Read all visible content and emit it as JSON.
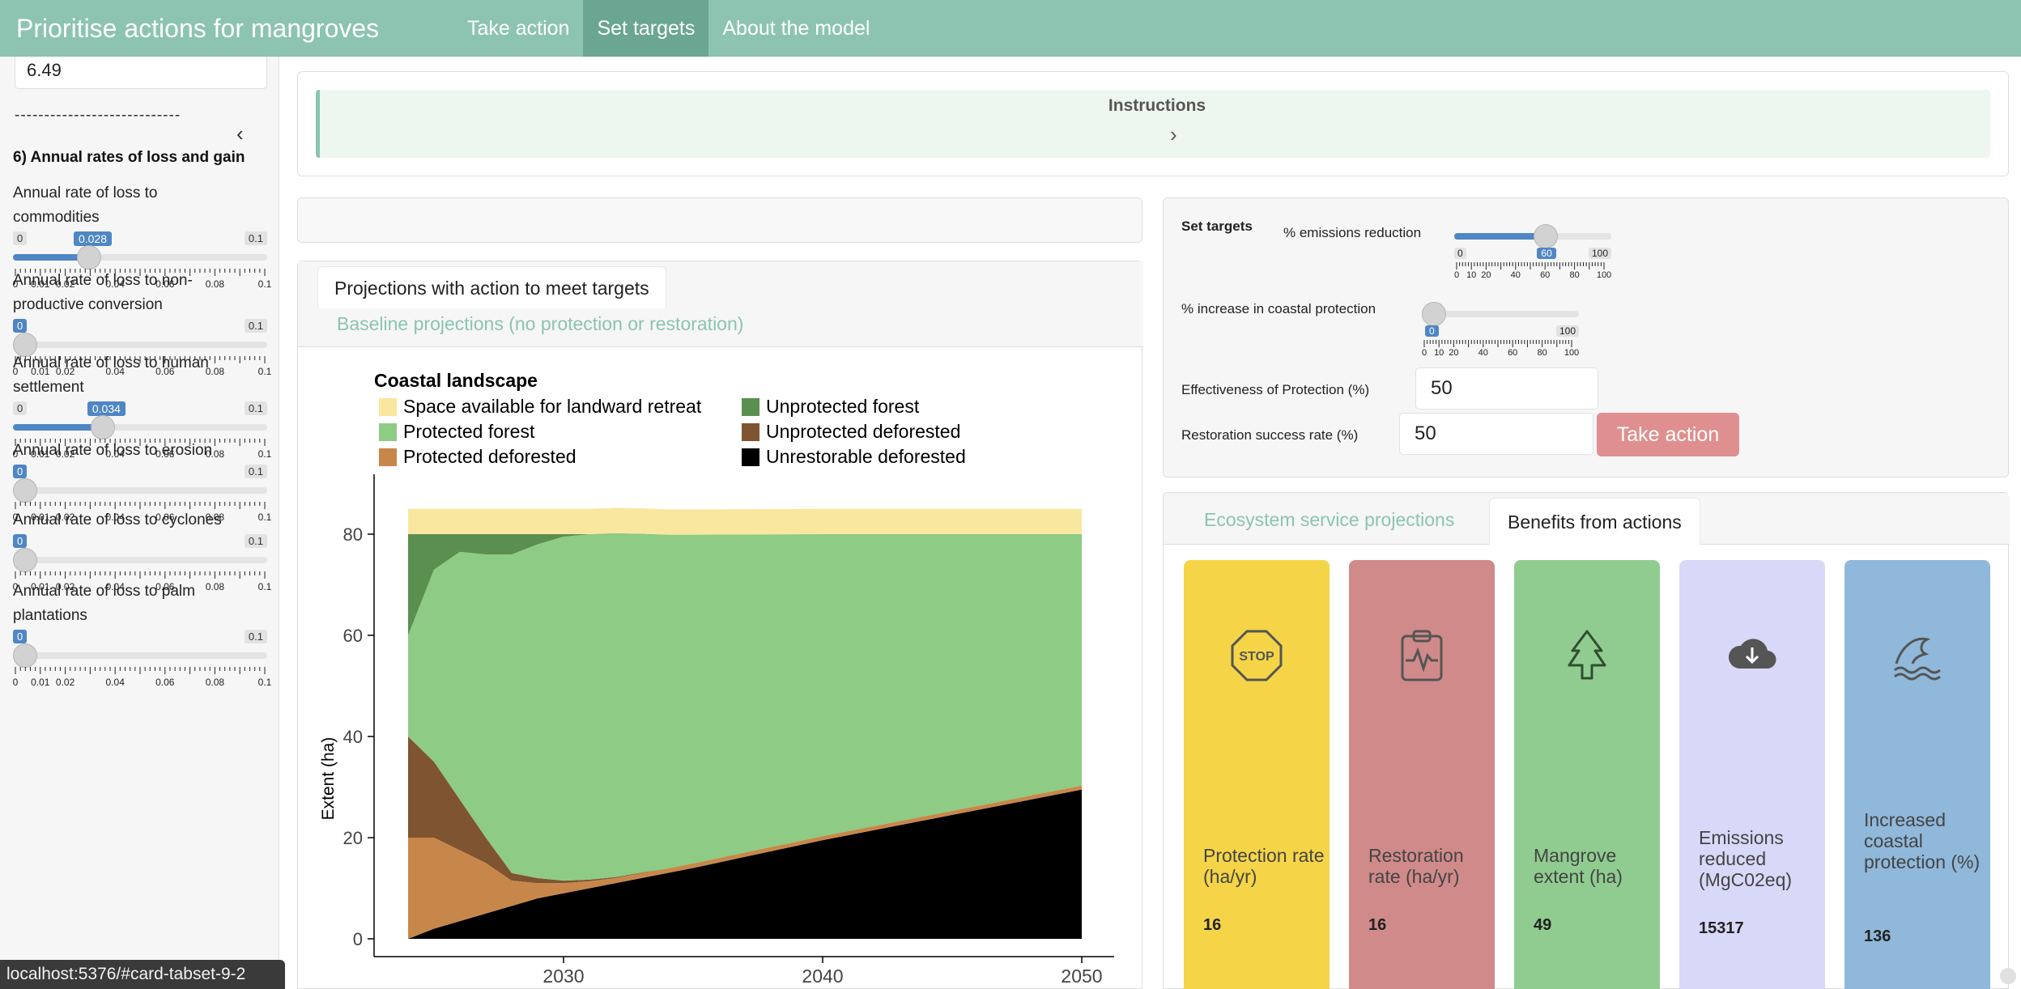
{
  "navbar": {
    "title": "Prioritise actions for mangroves",
    "links": [
      "Take action",
      "Set targets",
      "About the model"
    ],
    "active": "Set targets"
  },
  "sidebar": {
    "top_value": "6.49",
    "divider": "----------------------------",
    "section_heading": "6) Annual rates of loss and gain",
    "sliders": [
      {
        "label": "Annual rate of loss to commodities",
        "min": "0",
        "max": "0.1",
        "value": "0.028",
        "fraction": 0.28
      },
      {
        "label": "Annual rate of loss to non-productive conversion",
        "min": "0",
        "max": "0.1",
        "value": "0",
        "fraction": 0
      },
      {
        "label": "Annual rate of loss to human settlement",
        "min": "0",
        "max": "0.1",
        "value": "0.034",
        "fraction": 0.34
      },
      {
        "label": "Annual rate of loss to erosion",
        "min": "0",
        "max": "0.1",
        "value": "0",
        "fraction": 0
      },
      {
        "label": "Annual rate of loss to cyclones",
        "min": "0",
        "max": "0.1",
        "value": "0",
        "fraction": 0
      },
      {
        "label": "Annual rate of loss to palm plantations",
        "min": "0",
        "max": "0.1",
        "value": "0",
        "fraction": 0
      }
    ],
    "tick_labels": [
      "0",
      "0.01",
      "0.02",
      "0.04",
      "0.06",
      "0.08",
      "0.1"
    ]
  },
  "instructions": {
    "title": "Instructions"
  },
  "projections": {
    "tab_active": "Projections with action to meet targets",
    "tab_inactive": "Baseline projections (no protection or restoration)"
  },
  "chart_data": {
    "type": "area",
    "title": "Coastal landscape",
    "xlabel": "",
    "ylabel": "Extent (ha)",
    "xlim": [
      2024,
      2050
    ],
    "ylim": [
      0,
      88
    ],
    "x_ticks": [
      2030,
      2040,
      2050
    ],
    "y_ticks": [
      0,
      20,
      40,
      60,
      80
    ],
    "legend": [
      {
        "name": "Space available for landward retreat",
        "color": "#f9e79f"
      },
      {
        "name": "Unprotected forest",
        "color": "#5a8f50"
      },
      {
        "name": "Protected forest",
        "color": "#8ecb84"
      },
      {
        "name": "Unprotected deforested",
        "color": "#7f5430"
      },
      {
        "name": "Protected deforested",
        "color": "#c8874a"
      },
      {
        "name": "Unrestorable deforested",
        "color": "#000000"
      }
    ],
    "x": [
      2024,
      2025,
      2026,
      2027,
      2028,
      2029,
      2030,
      2031,
      2032,
      2033,
      2034,
      2035,
      2040,
      2045,
      2050
    ],
    "series": [
      {
        "name": "Unrestorable deforested",
        "values": [
          0,
          2,
          3.5,
          5,
          6.5,
          8,
          9,
          10,
          11,
          12,
          13,
          14,
          19.5,
          24.5,
          29.5
        ]
      },
      {
        "name": "Protected deforested",
        "values": [
          20,
          18,
          14,
          10,
          5,
          3,
          2,
          1.4,
          1,
          1,
          0.9,
          0.9,
          0.8,
          0.8,
          0.8
        ]
      },
      {
        "name": "Unprotected deforested",
        "values": [
          20,
          15,
          10,
          5,
          1.5,
          1,
          0.5,
          0.3,
          0.2,
          0.1,
          0,
          0,
          0,
          0,
          0
        ]
      },
      {
        "name": "Protected forest",
        "values": [
          20,
          38,
          49,
          56,
          63,
          66,
          68,
          68.3,
          68,
          67,
          66,
          65,
          59.7,
          54.7,
          49.7
        ]
      },
      {
        "name": "Unprotected forest",
        "values": [
          20,
          7,
          3.5,
          4,
          4,
          2,
          0.5,
          0,
          0,
          0,
          0,
          0,
          0,
          0,
          0
        ]
      },
      {
        "name": "Space available for landward retreat",
        "values": [
          5,
          5,
          5,
          5,
          5,
          5,
          5,
          5,
          5,
          5,
          5,
          5,
          5,
          5,
          5
        ]
      }
    ]
  },
  "targets": {
    "heading": "Set targets",
    "emissions_label": "% emissions reduction",
    "emissions_min": "0",
    "emissions_value": "60",
    "emissions_max": "100",
    "emissions_fraction": 0.6,
    "coastal_label": "% increase in coastal protection",
    "coastal_value": "0",
    "coastal_max": "100",
    "coastal_fraction": 0,
    "target_ticks": [
      "0",
      "10",
      "20",
      "40",
      "60",
      "80",
      "100"
    ],
    "effectiveness_label": "Effectiveness of Protection (%)",
    "effectiveness_value": "50",
    "restoration_label": "Restoration success rate (%)",
    "restoration_value": "50",
    "take_action_label": "Take action"
  },
  "benefits": {
    "tab_inactive": "Ecosystem service projections",
    "tab_active": "Benefits from actions",
    "cards": [
      {
        "title": "Protection rate (ha/yr)",
        "value": "16",
        "color": "#f5d547",
        "icon": "stop-sign-icon"
      },
      {
        "title": "Restoration rate (ha/yr)",
        "value": "16",
        "color": "#d08a8a",
        "icon": "clipboard-pulse-icon"
      },
      {
        "title": "Mangrove extent (ha)",
        "value": "49",
        "color": "#90cc90",
        "icon": "tree-icon"
      },
      {
        "title": "Emissions reduced (MgC02eq)",
        "value": "15317",
        "color": "#d8d8f8",
        "icon": "cloud-download-icon"
      },
      {
        "title": "Increased coastal protection (%)",
        "value": "136",
        "color": "#8fb8da",
        "icon": "wave-icon"
      }
    ]
  },
  "status_url": "localhost:5376/#card-tabset-9-2"
}
